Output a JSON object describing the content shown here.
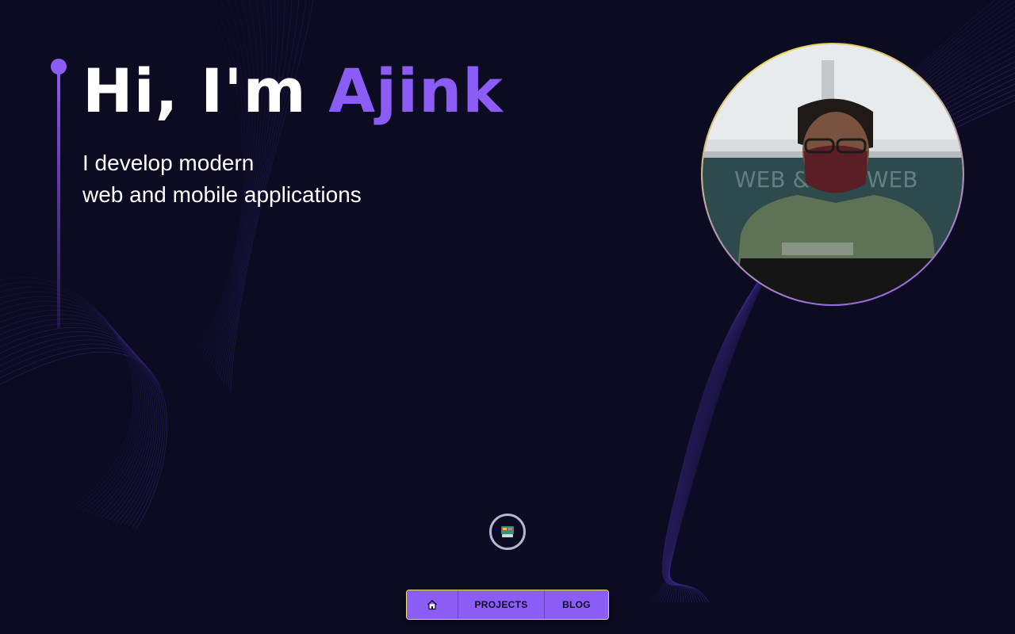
{
  "hero": {
    "greeting": "Hi, I'm ",
    "name": "Ajink",
    "tagline_line1": "I develop modern",
    "tagline_line2": "web and mobile applications"
  },
  "nav": {
    "home_icon": "home-icon",
    "projects_label": "PROJECTS",
    "blog_label": "BLOG"
  },
  "profile_photo": {
    "description_icon": "profile-photo"
  },
  "center_badge": {
    "icon": "emoji-badge-icon"
  },
  "colors": {
    "background": "#0c0b21",
    "accent": "#8b5cf6",
    "photo_border_top": "#f5e64a",
    "photo_border_bottom": "#8b5cf6",
    "text": "#ffffff"
  }
}
